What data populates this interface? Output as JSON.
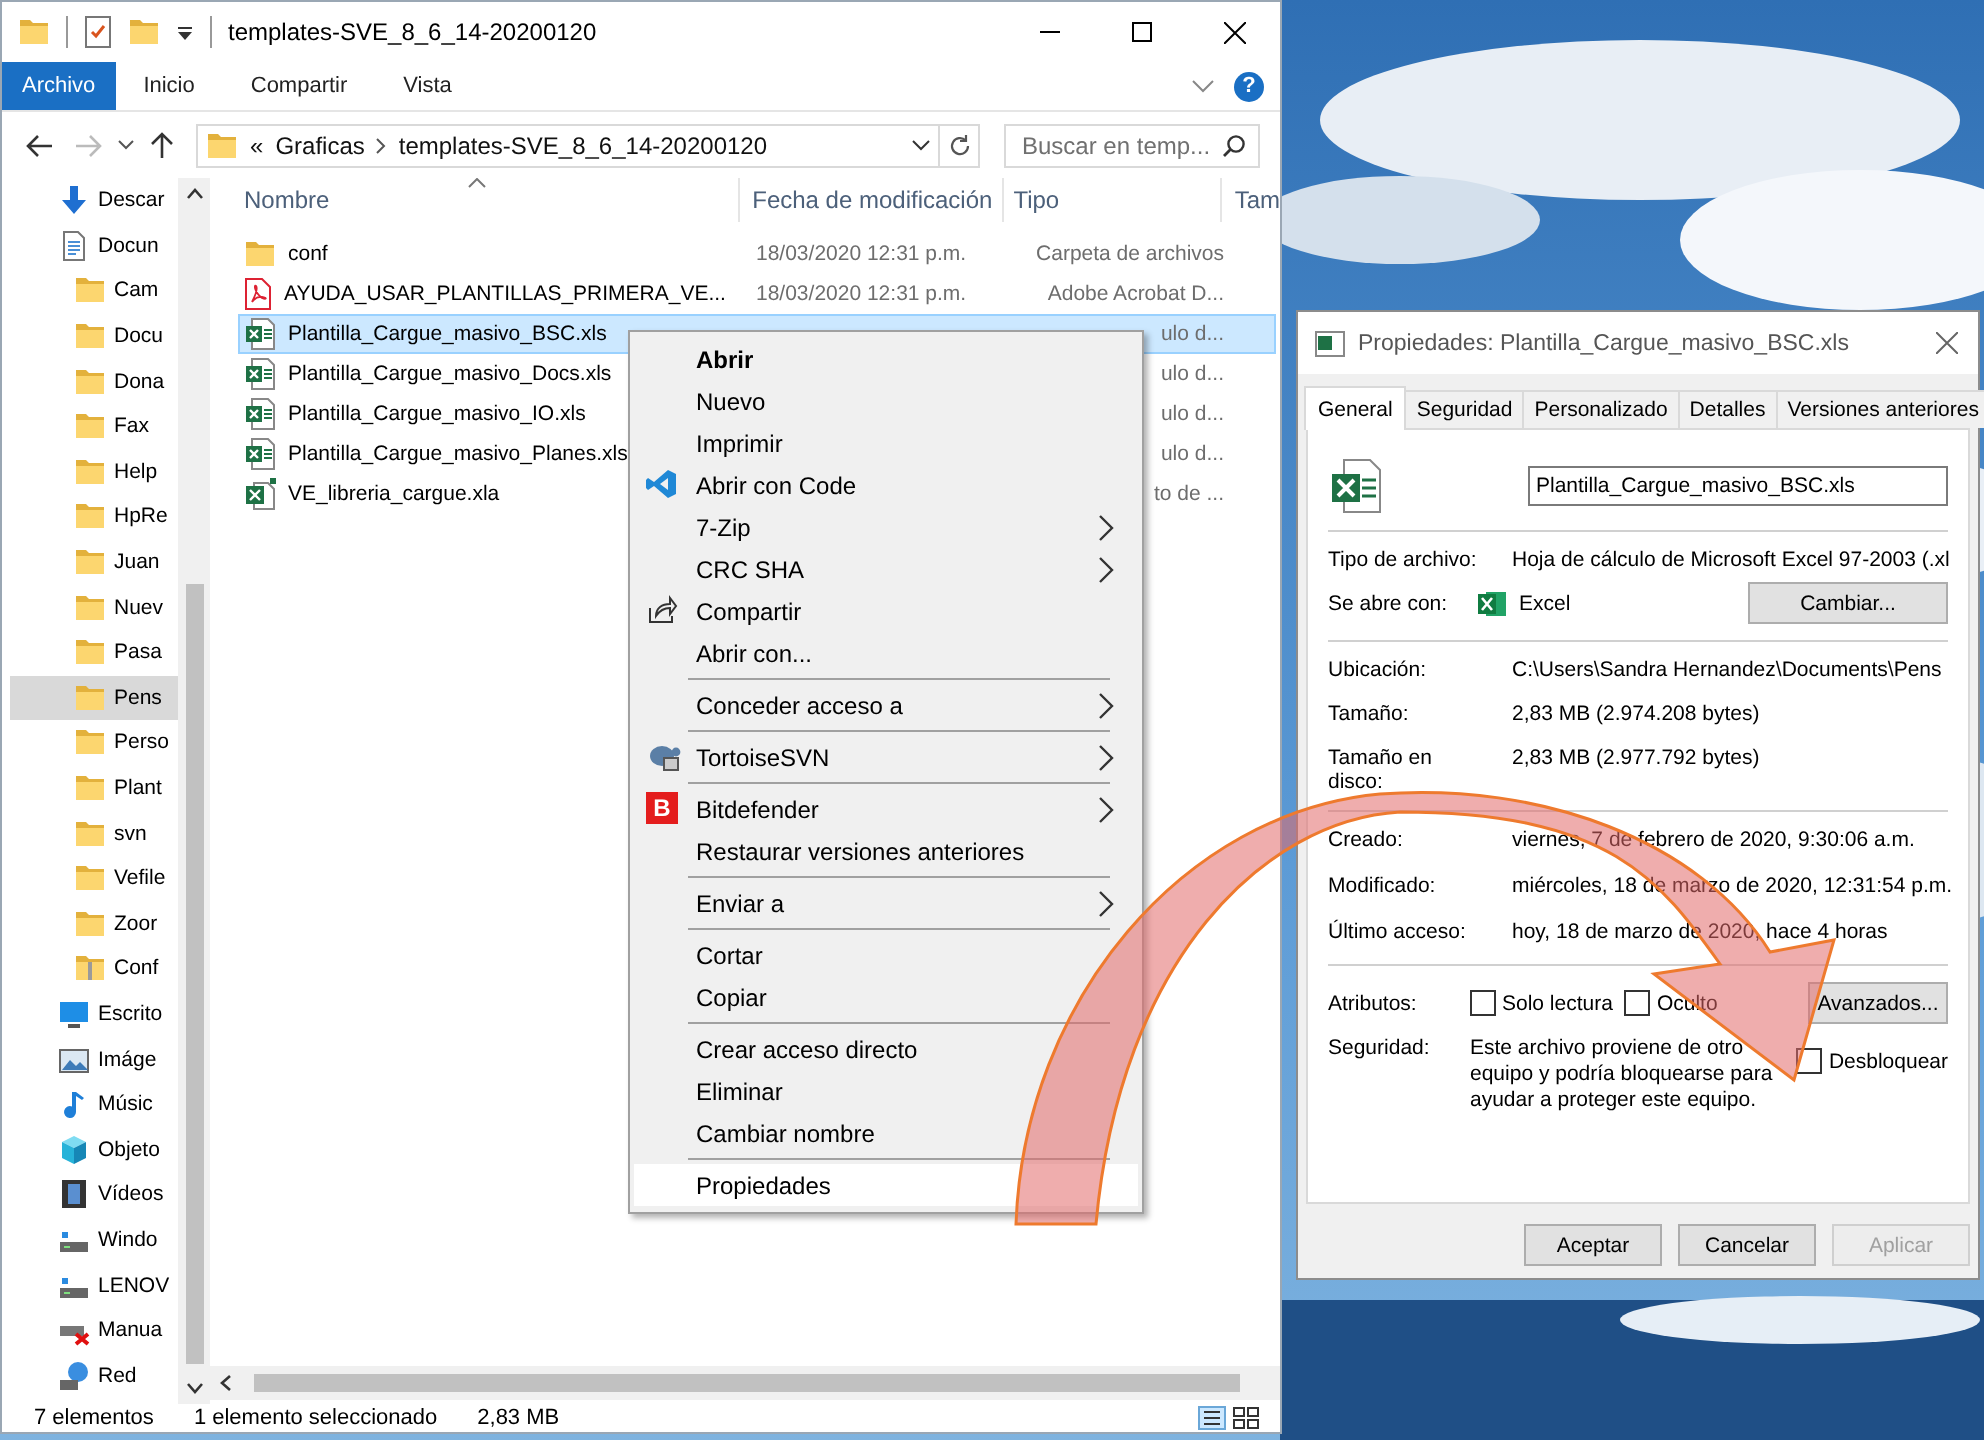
{
  "explorer": {
    "title": "templates-SVE_8_6_14-20200120",
    "ribbon_tabs": [
      {
        "label": "Archivo",
        "selected": true
      },
      {
        "label": "Inicio",
        "selected": false
      },
      {
        "label": "Compartir",
        "selected": false
      },
      {
        "label": "Vista",
        "selected": false
      }
    ],
    "help": "?",
    "nav": {
      "back": {
        "disabled": false
      },
      "forward": {
        "disabled": true
      }
    },
    "address": {
      "overflow": "«",
      "crumbs": [
        "Graficas",
        "templates-SVE_8_6_14-20200120"
      ]
    },
    "search": {
      "placeholder": "Buscar en temp..."
    },
    "sidebar": {
      "items": [
        {
          "kind": "downloads",
          "label": "Descar",
          "selected": false
        },
        {
          "kind": "documents",
          "label": "Docun",
          "selected": false,
          "children": [
            {
              "kind": "folder",
              "label": "Cam",
              "selected": false
            },
            {
              "kind": "folder",
              "label": "Docu",
              "selected": false
            },
            {
              "kind": "folder",
              "label": "Dona",
              "selected": false
            },
            {
              "kind": "folder",
              "label": "Fax",
              "selected": false
            },
            {
              "kind": "folder",
              "label": "Help",
              "selected": false
            },
            {
              "kind": "folder",
              "label": "HpRe",
              "selected": false
            },
            {
              "kind": "folder",
              "label": "Juan",
              "selected": false
            },
            {
              "kind": "folder",
              "label": "Nuev",
              "selected": false
            },
            {
              "kind": "folder",
              "label": "Pasa",
              "selected": false
            },
            {
              "kind": "folder",
              "label": "Pens",
              "selected": true
            },
            {
              "kind": "folder",
              "label": "Perso",
              "selected": false
            },
            {
              "kind": "folder",
              "label": "Plant",
              "selected": false
            },
            {
              "kind": "folder",
              "label": "svn",
              "selected": false
            },
            {
              "kind": "folder",
              "label": "Vefile",
              "selected": false
            },
            {
              "kind": "folder",
              "label": "Zoor",
              "selected": false
            },
            {
              "kind": "zip",
              "label": "Conf",
              "selected": false
            }
          ]
        },
        {
          "kind": "desktop",
          "label": "Escrito",
          "selected": false
        },
        {
          "kind": "pictures",
          "label": "Imáge",
          "selected": false
        },
        {
          "kind": "music",
          "label": "Músic",
          "selected": false
        },
        {
          "kind": "objects",
          "label": "Objeto",
          "selected": false
        },
        {
          "kind": "videos",
          "label": "Vídeos",
          "selected": false
        },
        {
          "kind": "drive",
          "label": "Windo",
          "selected": false
        },
        {
          "kind": "drive",
          "label": "LENOV",
          "selected": false
        },
        {
          "kind": "unmapped",
          "label": "Manua",
          "selected": false
        },
        {
          "kind": "network",
          "label": "Red",
          "selected": false
        }
      ]
    },
    "columns": [
      "Nombre",
      "Fecha de modificación",
      "Tipo",
      "Tam"
    ],
    "files": [
      {
        "kind": "folder",
        "name": "conf",
        "date": "18/03/2020 12:31 p.m.",
        "type": "Carpeta de archivos",
        "selected": false
      },
      {
        "kind": "pdf",
        "name": "AYUDA_USAR_PLANTILLAS_PRIMERA_VE...",
        "date": "18/03/2020 12:31 p.m.",
        "type": "Adobe Acrobat D...",
        "selected": false
      },
      {
        "kind": "spreadsheet",
        "name": "Plantilla_Cargue_masivo_BSC.xls",
        "type": "ulo d...",
        "selected": true
      },
      {
        "kind": "spreadsheet",
        "name": "Plantilla_Cargue_masivo_Docs.xls",
        "type": "ulo d...",
        "selected": false
      },
      {
        "kind": "spreadsheet",
        "name": "Plantilla_Cargue_masivo_IO.xls",
        "type": "ulo d...",
        "selected": false
      },
      {
        "kind": "spreadsheet",
        "name": "Plantilla_Cargue_masivo_Planes.xls",
        "type": "ulo d...",
        "selected": false
      },
      {
        "kind": "addin",
        "name": "VE_libreria_cargue.xla",
        "type": "to de ...",
        "selected": false
      }
    ],
    "status": {
      "count": "7 elementos",
      "selection": "1 elemento seleccionado",
      "size": "2,83 MB"
    }
  },
  "context_menu": {
    "items": [
      {
        "kind": "item",
        "label": "Abrir",
        "default": true,
        "submenu": false,
        "selected": false
      },
      {
        "kind": "item",
        "label": "Nuevo",
        "default": false,
        "submenu": false,
        "selected": false
      },
      {
        "kind": "item",
        "label": "Imprimir",
        "default": false,
        "submenu": false,
        "selected": false
      },
      {
        "kind": "item",
        "label": "Abrir con Code",
        "default": false,
        "submenu": false,
        "selected": false
      },
      {
        "kind": "item",
        "label": "7-Zip",
        "default": false,
        "submenu": true,
        "selected": false
      },
      {
        "kind": "item",
        "label": "CRC SHA",
        "default": false,
        "submenu": true,
        "selected": false
      },
      {
        "kind": "item",
        "label": "Compartir",
        "default": false,
        "submenu": false,
        "selected": false
      },
      {
        "kind": "item",
        "label": "Abrir con...",
        "default": false,
        "submenu": false,
        "selected": false
      },
      {
        "kind": "separator"
      },
      {
        "kind": "item",
        "label": "Conceder acceso a",
        "default": false,
        "submenu": true,
        "selected": false
      },
      {
        "kind": "separator"
      },
      {
        "kind": "item",
        "label": "TortoiseSVN",
        "default": false,
        "submenu": true,
        "selected": false
      },
      {
        "kind": "separator"
      },
      {
        "kind": "item",
        "label": "Bitdefender",
        "badge": "B",
        "default": false,
        "submenu": true,
        "selected": false
      },
      {
        "kind": "item",
        "label": "Restaurar versiones anteriores",
        "default": false,
        "submenu": false,
        "selected": false
      },
      {
        "kind": "separator"
      },
      {
        "kind": "item",
        "label": "Enviar a",
        "default": false,
        "submenu": true,
        "selected": false
      },
      {
        "kind": "separator"
      },
      {
        "kind": "item",
        "label": "Cortar",
        "default": false,
        "submenu": false,
        "selected": false
      },
      {
        "kind": "item",
        "label": "Copiar",
        "default": false,
        "submenu": false,
        "selected": false
      },
      {
        "kind": "separator"
      },
      {
        "kind": "item",
        "label": "Crear acceso directo",
        "default": false,
        "submenu": false,
        "selected": false
      },
      {
        "kind": "item",
        "label": "Eliminar",
        "default": false,
        "submenu": false,
        "selected": false
      },
      {
        "kind": "item",
        "label": "Cambiar nombre",
        "default": false,
        "submenu": false,
        "selected": false
      },
      {
        "kind": "separator"
      },
      {
        "kind": "item",
        "label": "Propiedades",
        "default": false,
        "submenu": false,
        "selected": true
      }
    ]
  },
  "properties": {
    "title": "Propiedades: Plantilla_Cargue_masivo_BSC.xls",
    "tabs": [
      {
        "label": "General",
        "selected": true
      },
      {
        "label": "Seguridad",
        "selected": false
      },
      {
        "label": "Personalizado",
        "selected": false
      },
      {
        "label": "Detalles",
        "selected": false
      },
      {
        "label": "Versiones anteriores",
        "selected": false
      }
    ],
    "file_name": "Plantilla_Cargue_masivo_BSC.xls",
    "file_type": {
      "label": "Tipo de archivo:",
      "value": "Hoja de cálculo de Microsoft Excel 97-2003 (.xl"
    },
    "opens_with": {
      "label": "Se abre con:",
      "app": "Excel",
      "button": "Cambiar..."
    },
    "location": [
      {
        "label": "Ubicación:",
        "value": "C:\\Users\\Sandra Hernandez\\Documents\\Pens"
      },
      {
        "label": "Tamaño:",
        "value": "2,83 MB (2.974.208 bytes)"
      },
      {
        "label": "Tamaño en disco:",
        "value": "2,83 MB (2.977.792 bytes)"
      }
    ],
    "dates": [
      {
        "label": "Creado:",
        "value": "viernes, 7 de febrero de 2020, 9:30:06 a.m."
      },
      {
        "label": "Modificado:",
        "value": "miércoles, 18 de marzo de 2020, 12:31:54 p.m."
      },
      {
        "label": "Último acceso:",
        "value": "hoy, 18 de marzo de 2020, hace 4 horas"
      }
    ],
    "attributes": {
      "label": "Atributos:",
      "options": [
        {
          "label": "Solo lectura",
          "checked": false
        },
        {
          "label": "Oculto",
          "checked": false
        }
      ],
      "button": "Avanzados..."
    },
    "security": {
      "label": "Seguridad:",
      "text": "Este archivo proviene de otro equipo y podría bloquearse para ayudar a proteger este equipo.",
      "unblock": {
        "label": "Desbloquear",
        "checked": false
      }
    },
    "buttons": [
      {
        "label": "Aceptar",
        "disabled": false
      },
      {
        "label": "Cancelar",
        "disabled": false
      },
      {
        "label": "Aplicar",
        "disabled": true
      }
    ]
  }
}
